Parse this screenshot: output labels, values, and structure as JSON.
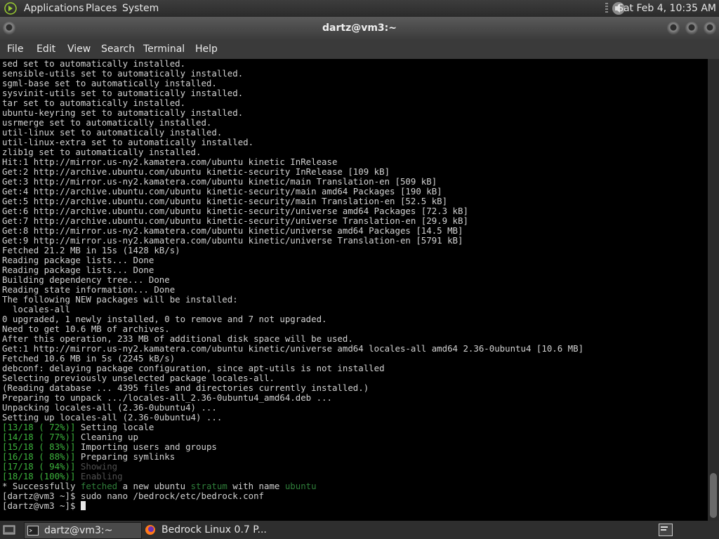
{
  "top_panel": {
    "menus": [
      "Applications",
      "Places",
      "System"
    ],
    "clock": "Sat Feb  4, 10:35 AM",
    "icons": {
      "logo": "gnome-foot-icon",
      "volume": "speaker-icon"
    }
  },
  "window": {
    "title": "dartz@vm3:~",
    "menu": [
      "File",
      "Edit",
      "View",
      "Search",
      "Terminal",
      "Help"
    ]
  },
  "terminal": {
    "lines": [
      "sed set to automatically installed.",
      "sensible-utils set to automatically installed.",
      "sgml-base set to automatically installed.",
      "sysvinit-utils set to automatically installed.",
      "tar set to automatically installed.",
      "ubuntu-keyring set to automatically installed.",
      "usrmerge set to automatically installed.",
      "util-linux set to automatically installed.",
      "util-linux-extra set to automatically installed.",
      "zlib1g set to automatically installed.",
      "Hit:1 http://mirror.us-ny2.kamatera.com/ubuntu kinetic InRelease",
      "Get:2 http://archive.ubuntu.com/ubuntu kinetic-security InRelease [109 kB]",
      "Get:3 http://mirror.us-ny2.kamatera.com/ubuntu kinetic/main Translation-en [509 kB]",
      "Get:4 http://archive.ubuntu.com/ubuntu kinetic-security/main amd64 Packages [190 kB]",
      "Get:5 http://archive.ubuntu.com/ubuntu kinetic-security/main Translation-en [52.5 kB]",
      "Get:6 http://archive.ubuntu.com/ubuntu kinetic-security/universe amd64 Packages [72.3 kB]",
      "Get:7 http://archive.ubuntu.com/ubuntu kinetic-security/universe Translation-en [29.9 kB]",
      "Get:8 http://mirror.us-ny2.kamatera.com/ubuntu kinetic/universe amd64 Packages [14.5 MB]",
      "Get:9 http://mirror.us-ny2.kamatera.com/ubuntu kinetic/universe Translation-en [5791 kB]",
      "Fetched 21.2 MB in 15s (1428 kB/s)",
      "Reading package lists... Done",
      "Reading package lists... Done",
      "Building dependency tree... Done",
      "Reading state information... Done",
      "The following NEW packages will be installed:",
      "  locales-all",
      "0 upgraded, 1 newly installed, 0 to remove and 7 not upgraded.",
      "Need to get 10.6 MB of archives.",
      "After this operation, 233 MB of additional disk space will be used.",
      "Get:1 http://mirror.us-ny2.kamatera.com/ubuntu kinetic/universe amd64 locales-all amd64 2.36-0ubuntu4 [10.6 MB]",
      "Fetched 10.6 MB in 5s (2245 kB/s)",
      "debconf: delaying package configuration, since apt-utils is not installed",
      "Selecting previously unselected package locales-all.",
      "(Reading database ... 4395 files and directories currently installed.)",
      "Preparing to unpack .../locales-all_2.36-0ubuntu4_amd64.deb ...",
      "Unpacking locales-all (2.36-0ubuntu4) ...",
      "Setting up locales-all (2.36-0ubuntu4) ..."
    ],
    "steps": [
      {
        "counter": "[13/18 ( 72%)]",
        "label": "Setting locale",
        "dim": false
      },
      {
        "counter": "[14/18 ( 77%)]",
        "label": "Cleaning up",
        "dim": false
      },
      {
        "counter": "[15/18 ( 83%)]",
        "label": "Importing users and groups",
        "dim": false
      },
      {
        "counter": "[16/18 ( 88%)]",
        "label": "Preparing symlinks",
        "dim": false
      },
      {
        "counter": "[17/18 ( 94%)]",
        "label": "Showing",
        "dim": true
      },
      {
        "counter": "[18/18 (100%)]",
        "label": "Enabling",
        "dim": true
      }
    ],
    "success": {
      "prefix": "* Successfully ",
      "w1": "fetched",
      "mid": " a new ubuntu ",
      "w2": "stratum",
      "mid2": " with name ",
      "w3": "ubuntu"
    },
    "prompt": "[dartz@vm3 ~]$",
    "command": "sudo nano /bedrock/etc/bedrock.conf",
    "prompt2": "[dartz@vm3 ~]$"
  },
  "bottom_panel": {
    "tasks": [
      {
        "label": "dartz@vm3:~",
        "icon": "terminal-icon"
      },
      {
        "label": "Bedrock Linux 0.7 P...",
        "icon": "firefox-icon"
      }
    ],
    "icons": {
      "show_desktop": "show-desktop-icon",
      "workspace": "workspace-icon"
    }
  },
  "colors": {
    "step_counter": "#3cb33c",
    "dim_label": "#505050",
    "success_highlight": "#2f7f3a"
  }
}
